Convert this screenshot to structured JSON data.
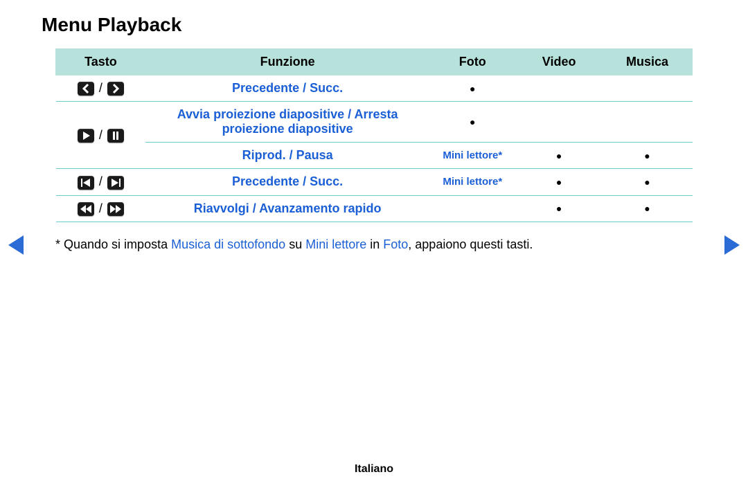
{
  "title": "Menu Playback",
  "headers": {
    "tasto": "Tasto",
    "funzione": "Funzione",
    "foto": "Foto",
    "video": "Video",
    "musica": "Musica"
  },
  "rows": {
    "r1": {
      "funzione": "Precedente / Succ.",
      "foto": "●",
      "video": "",
      "musica": ""
    },
    "r2": {
      "funzione": "Avvia proiezione diapositive / Arresta proiezione diapositive",
      "foto": "●",
      "video": "",
      "musica": ""
    },
    "r3": {
      "funzione": "Riprod. / Pausa",
      "foto": "Mini lettore*",
      "video": "●",
      "musica": "●"
    },
    "r4": {
      "funzione": "Precedente / Succ.",
      "foto": "Mini lettore*",
      "video": "●",
      "musica": "●"
    },
    "r5": {
      "funzione": "Riavvolgi / Avanzamento rapido",
      "foto": "",
      "video": "●",
      "musica": "●"
    }
  },
  "note": {
    "prefix": "* Quando si imposta ",
    "a": "Musica di sottofondo",
    "mid1": " su ",
    "b": "Mini lettore",
    "mid2": " in ",
    "c": "Foto",
    "suffix": ", appaiono questi tasti."
  },
  "language": "Italiano",
  "slash": " / "
}
